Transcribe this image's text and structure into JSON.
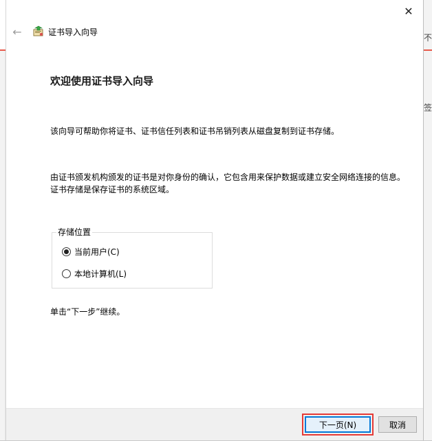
{
  "window": {
    "close_glyph": "✕",
    "back_glyph": "←",
    "title": "证书导入向导",
    "icon": "certificate-wizard-icon"
  },
  "page": {
    "heading": "欢迎使用证书导入向导",
    "para1": "该向导可帮助你将证书、证书信任列表和证书吊销列表从磁盘复制到证书存储。",
    "para2": "由证书颁发机构颁发的证书是对你身份的确认，它包含用来保护数据或建立安全网络连接的信息。证书存储是保存证书的系统区域。",
    "store_location": {
      "legend": "存储位置",
      "options": [
        {
          "label": "当前用户(C)",
          "checked": true
        },
        {
          "label": "本地计算机(L)",
          "checked": false
        }
      ]
    },
    "continue_hint": "单击“下一步”继续。"
  },
  "footer": {
    "next_label": "下一页(N)",
    "cancel_label": "取消"
  },
  "background": {
    "right_text1": "不",
    "right_text2": "签"
  },
  "colors": {
    "accent": "#0078d7",
    "highlight": "#e53935",
    "footer_bg": "#f0f0f0"
  }
}
